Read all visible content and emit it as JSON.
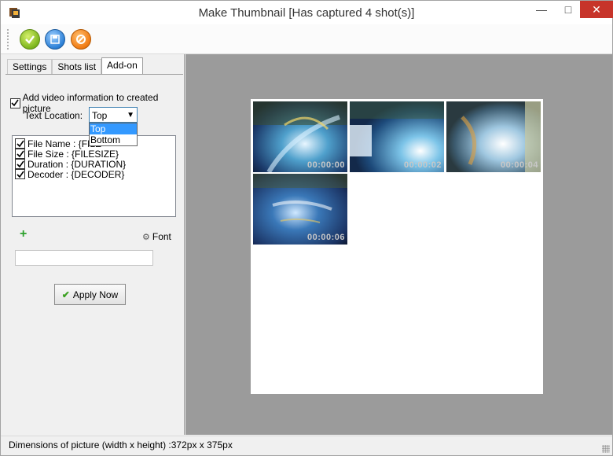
{
  "window": {
    "title": "Make Thumbnail [Has captured 4 shot(s)]",
    "controls": {
      "minimize": "—",
      "maximize": "□",
      "close": "✕"
    }
  },
  "toolbar": {
    "buttons": [
      {
        "icon": "check-icon"
      },
      {
        "icon": "save-icon"
      },
      {
        "icon": "cancel-icon"
      }
    ]
  },
  "tabs": [
    {
      "label": "Settings"
    },
    {
      "label": "Shots list"
    },
    {
      "label": "Add-on",
      "active": true
    }
  ],
  "addon": {
    "add_info_label": "Add video information to created picture",
    "add_info_checked": true,
    "text_location_label": "Text Location:",
    "text_location_value": "Top",
    "text_location_options": [
      "Top",
      "Bottom"
    ],
    "fields": [
      {
        "label": "File Name : {FILE",
        "checked": true
      },
      {
        "label": "File Size : {FILESIZE}",
        "checked": true
      },
      {
        "label": "Duration : {DURATION}",
        "checked": true
      },
      {
        "label": "Decoder : {DECODER}",
        "checked": true
      }
    ],
    "font_label": "Font",
    "text_input_value": "",
    "apply_label": "Apply Now"
  },
  "thumbnails": [
    {
      "timestamp": "00:00:00"
    },
    {
      "timestamp": "00:00:02"
    },
    {
      "timestamp": "00:00:04"
    },
    {
      "timestamp": "00:00:06"
    }
  ],
  "status": {
    "text": "Dimensions of picture (width x height) :372px x 375px"
  },
  "colors": {
    "close_button": "#c7342a",
    "selection": "#3399ff",
    "preview_bg": "#9b9b9b"
  }
}
